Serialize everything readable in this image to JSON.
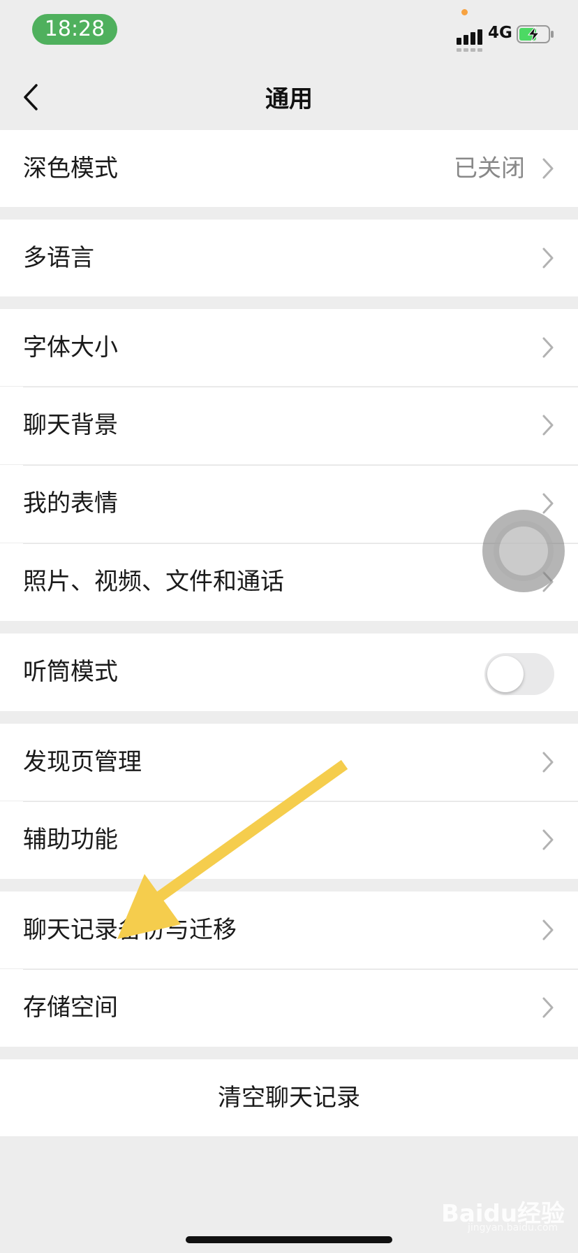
{
  "status_bar": {
    "time": "18:28",
    "network": "4G"
  },
  "nav": {
    "title": "通用"
  },
  "rows": [
    {
      "label": "深色模式",
      "value": "已关闭"
    },
    {
      "label": "多语言"
    },
    {
      "label": "字体大小"
    },
    {
      "label": "聊天背景"
    },
    {
      "label": "我的表情"
    },
    {
      "label": "照片、视频、文件和通话"
    },
    {
      "label": "听筒模式",
      "toggle_on": false
    },
    {
      "label": "发现页管理"
    },
    {
      "label": "辅助功能"
    },
    {
      "label": "聊天记录备份与迁移"
    },
    {
      "label": "存储空间"
    }
  ],
  "clear_button": {
    "label": "清空聊天记录"
  },
  "watermark": {
    "text": "Baidu经验",
    "sub": "jingyan.baidu.com"
  },
  "colors": {
    "time_pill": "#4fb05d",
    "annotation_arrow": "#f5cd4d",
    "background": "#ededed"
  },
  "icons": [
    "chevron-left-icon",
    "chevron-right-icon",
    "signal-icon",
    "battery-charging-icon"
  ]
}
